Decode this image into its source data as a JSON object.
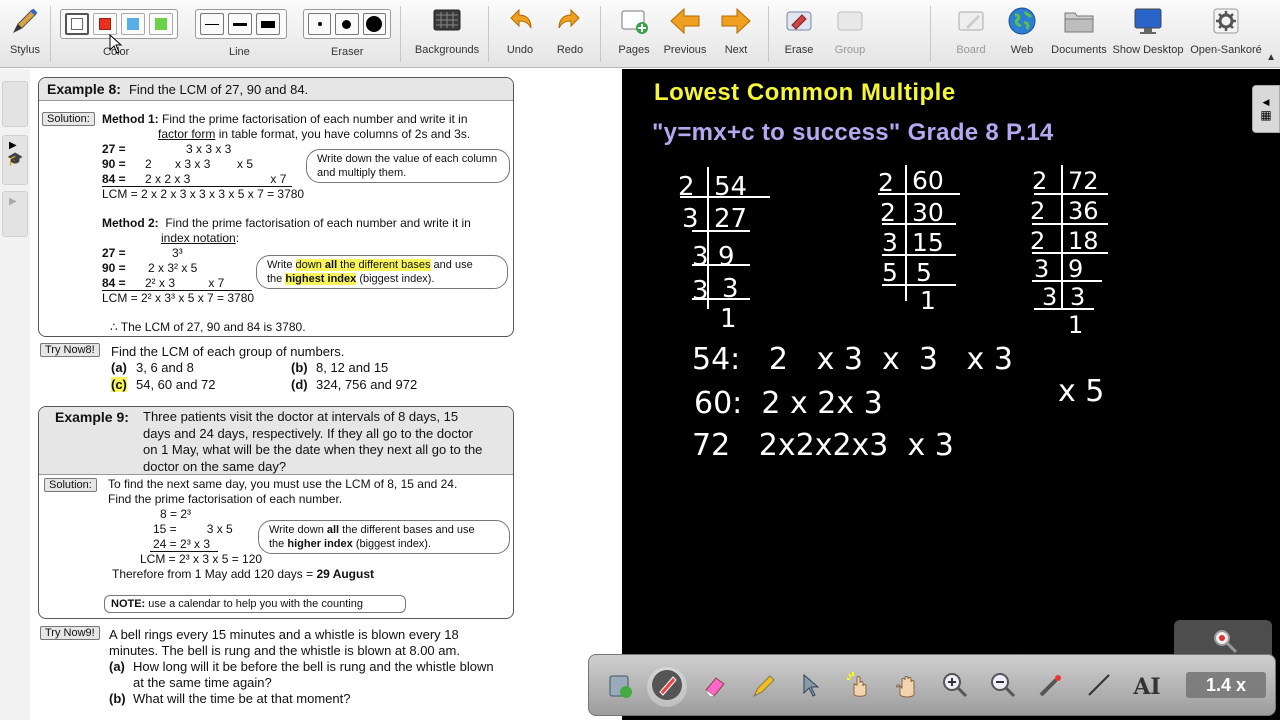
{
  "toolbar": {
    "stylus": "Stylus",
    "color": "Color",
    "line": "Line",
    "eraser": "Eraser",
    "backgrounds": "Backgrounds",
    "undo": "Undo",
    "redo": "Redo",
    "pages": "Pages",
    "previous": "Previous",
    "next": "Next",
    "erase": "Erase",
    "group": "Group",
    "board": "Board",
    "web": "Web",
    "documents": "Documents",
    "show_desktop": "Show Desktop",
    "open_sankore": "Open-Sankoré",
    "colors": [
      "#ffffff",
      "#e8321e",
      "#5aaee8",
      "#6ed14a"
    ]
  },
  "example8": {
    "label": "Example 8:",
    "question": "Find the LCM of 27, 90 and 84.",
    "solution_tag": "Solution:",
    "m1_label": "Method 1:",
    "m1_text_a": "Find the prime factorisation of each number and write it in",
    "m1_text_b1": "factor form",
    "m1_text_b2": " in table format, you have columns of 2s and 3s.",
    "m1_r1_label": "27 =",
    "m1_r1_vals": "3 x 3 x 3",
    "m1_r2_label": "90 =",
    "m1_r2_vals": "2       x 3 x 3        x 5",
    "m1_r3_label": "84 =",
    "m1_r3_vals": "2 x 2 x 3                        x 7",
    "m1_result": "LCM = 2 x 2 x 3 x 3 x 3  x 5 x 7 = 3780",
    "m1_bubble": "Write down the value of each column and multiply them.",
    "m2_label": "Method 2:",
    "m2_text_a": "Find the prime factorisation of each number and write it in",
    "m2_text_b": "index notation",
    "m2_text_b_colon": ":",
    "m2_r1_label": "27 =",
    "m2_r1_vals": "3³",
    "m2_r2_label": "90 =",
    "m2_r2_vals": "2 x 3² x 5",
    "m2_r3_label": "84 =",
    "m2_r3_vals": "2² x 3          x 7",
    "m2_result": "LCM = 2² x 3³ x 5  x 7 = 3780",
    "m2_bubble_1": "Write ",
    "m2_bubble_2": "down ",
    "m2_bubble_3": "all",
    "m2_bubble_4": " the different bases",
    "m2_bubble_5": " and use",
    "m2_bubble_6": "the ",
    "m2_bubble_7": "highest index",
    "m2_bubble_8": " (biggest index).",
    "conclusion": "∴ The LCM of 27, 90 and 84 is 3780."
  },
  "try8": {
    "tag": "Try Now8!",
    "prompt": "Find the LCM of each group of numbers.",
    "a_label": "(a)",
    "a": "3, 6 and 8",
    "b_label": "(b)",
    "b": "8, 12 and 15",
    "c_label": "(c)",
    "c": "54, 60 and 72",
    "d_label": "(d)",
    "d": "324, 756 and 972"
  },
  "example9": {
    "label": "Example 9:",
    "q1": "Three patients visit the doctor at intervals of 8 days, 15",
    "q2": "days and 24 days, respectively.  If they all go to the doctor",
    "q3": "on 1 May, what will be the date when they next all go to the",
    "q4": "doctor on the same day?",
    "solution_tag": "Solution:",
    "s1": "To find the next same day, you must use the LCM of 8, 15 and 24.",
    "s2": "Find the prime factorisation of each number.",
    "r1": "8 = 2³",
    "r2": "15 =         3 x 5",
    "r3": "24 = 2³ x 3",
    "lcm": "LCM = 2³ x 3 x 5 = 120",
    "therefore": "Therefore from 1 May add 120 days = ",
    "answer": "29 August",
    "bubble_1": "Write down ",
    "bubble_2": "all",
    "bubble_3": " the different bases and use",
    "bubble_4": "the ",
    "bubble_5": "higher index",
    "bubble_6": " (biggest index).",
    "note_label": "NOTE:",
    "note_text": " use a calendar to help you with the counting"
  },
  "try9": {
    "tag": "Try Now9!",
    "p1": "A bell rings every 15 minutes and a whistle is blown every 18",
    "p2": "minutes.  The bell is rung and the whistle is blown at 8.00 am.",
    "a_label": "(a)",
    "a1": "How long will it be before the bell is rung and the whistle blown",
    "a2": "at the same time again?",
    "b_label": "(b)",
    "b": "What will the time be at that moment?"
  },
  "board": {
    "title": "Lowest  Common Multiple",
    "subtitle": "\"y=mx+c to success\"  Grade 8   P.14",
    "ink_col1": [
      "2",
      "54",
      "3",
      "27",
      "3",
      "9",
      "3",
      "3",
      "1"
    ],
    "ink_col2": [
      "2",
      "60",
      "2",
      "30",
      "3",
      "15",
      "5",
      "5",
      "1"
    ],
    "ink_col3": [
      "2",
      "72",
      "2",
      "36",
      "2",
      "18",
      "3",
      "9",
      "3",
      "3",
      "1"
    ],
    "line54": "54:   2   x 3  x  3   x 3",
    "line60": "60:  2 x 2x 3",
    "line60_extra": "x 5",
    "line72": "72   2x2x2x3  x 3"
  },
  "zoom": {
    "label": "1.4 x"
  }
}
